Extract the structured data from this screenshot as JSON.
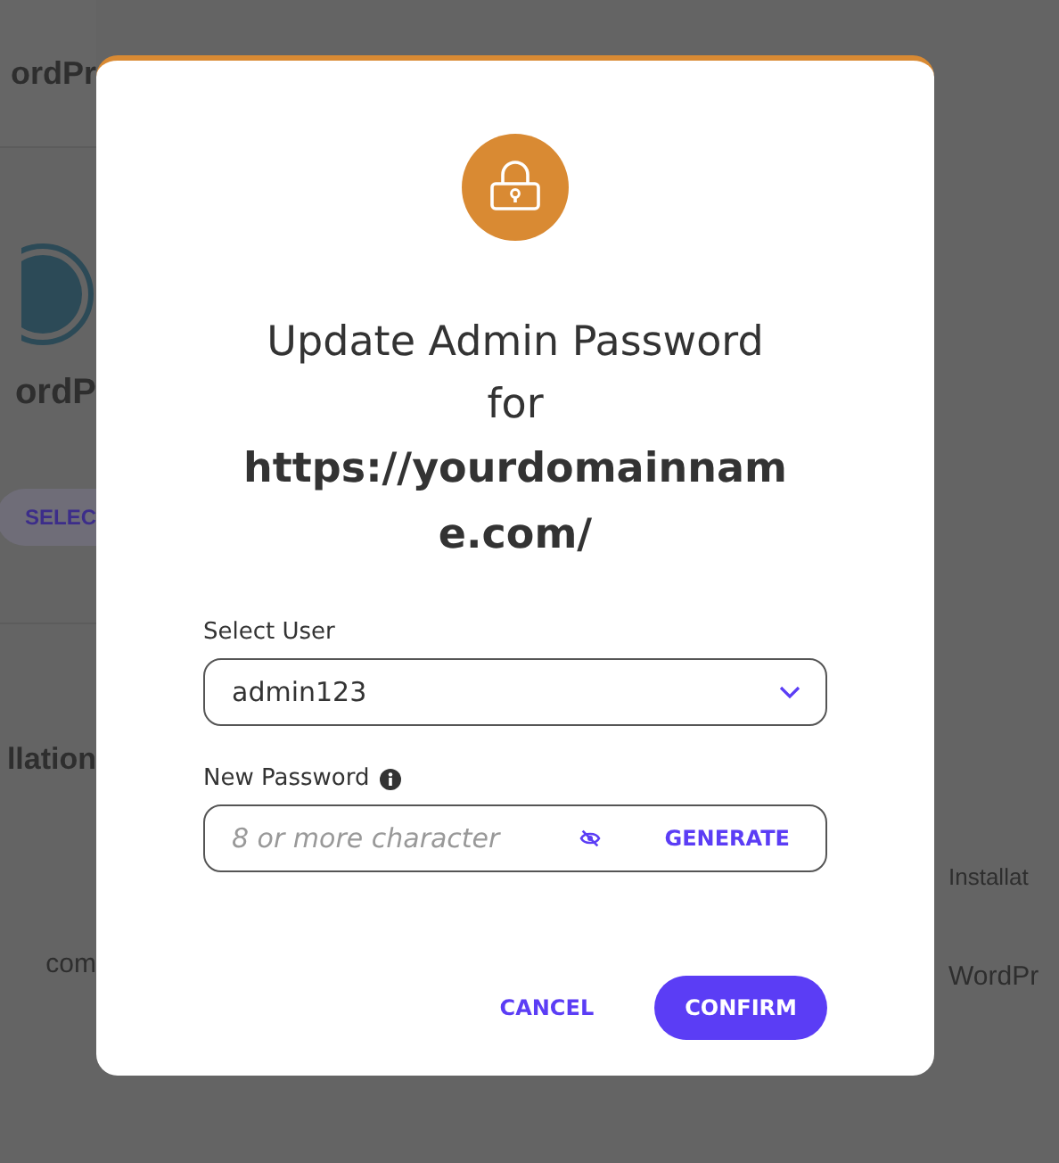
{
  "background": {
    "header_title": "ordPr",
    "app_name": "ordP",
    "select_button": "SELEC",
    "section_title": "llation",
    "row_left": "com",
    "column_header": "Installat",
    "row_right": "WordPr"
  },
  "dialog": {
    "title": "Update Admin Password for",
    "url": "https://yourdomainname.com/",
    "user_field": {
      "label": "Select User",
      "value": "admin123"
    },
    "password_field": {
      "label": "New Password",
      "placeholder": "8 or more character",
      "visible": false,
      "generate": "GENERATE"
    },
    "buttons": [
      {
        "label": "CANCEL",
        "kind": "text"
      },
      {
        "label": "CONFIRM",
        "kind": "primary"
      }
    ]
  }
}
